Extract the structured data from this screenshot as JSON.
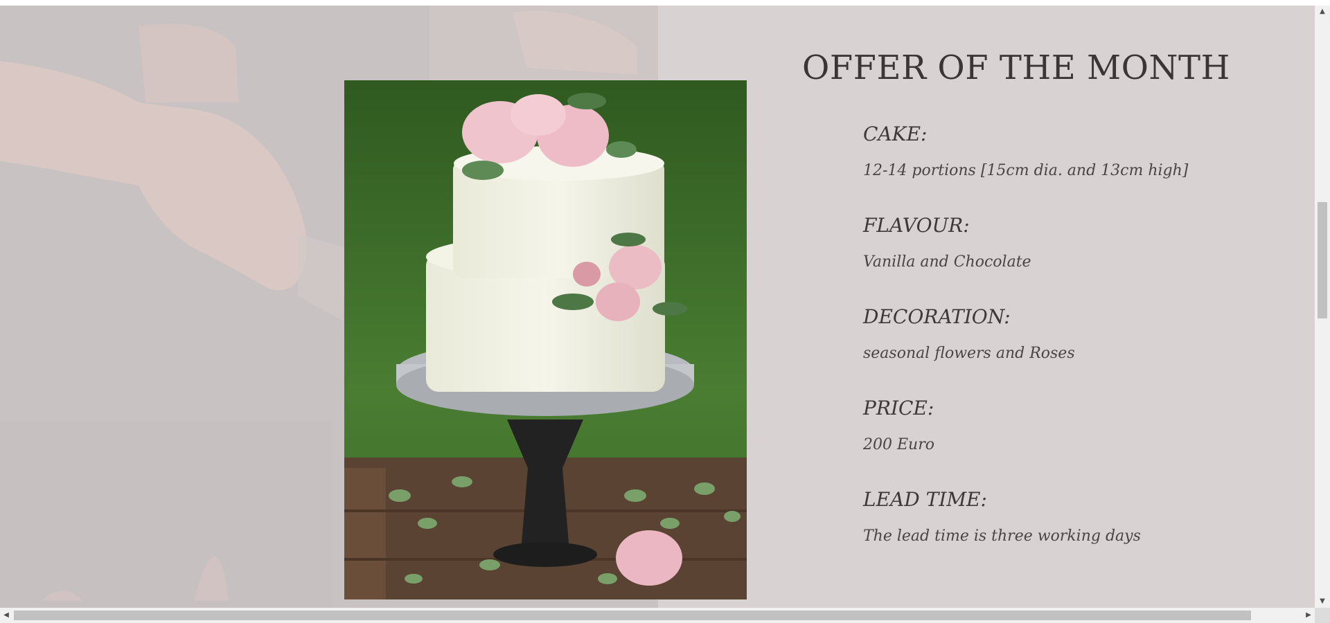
{
  "offer": {
    "title": "OFFER OF THE MONTH",
    "items": [
      {
        "label": "CAKE:",
        "value": "12-14 portions [15cm dia. and 13cm high]"
      },
      {
        "label": "FLAVOUR:",
        "value": "Vanilla and Chocolate"
      },
      {
        "label": "DECORATION:",
        "value": "seasonal flowers and Roses"
      },
      {
        "label": "PRICE:",
        "value": "200 Euro"
      },
      {
        "label": "LEAD TIME:",
        "value": "The lead time is three working days"
      }
    ]
  },
  "images": {
    "background": "faded-hands-cutting-cake-photo",
    "cake": "two-tier-white-cake-with-pink-peonies-photo"
  },
  "colors": {
    "page_background": "#d8d3d2",
    "text": "#3b3535"
  },
  "scrollbars": {
    "vertical_arrow_up": "▲",
    "vertical_arrow_down": "▼",
    "horizontal_arrow_left": "◀",
    "horizontal_arrow_right": "▶"
  }
}
